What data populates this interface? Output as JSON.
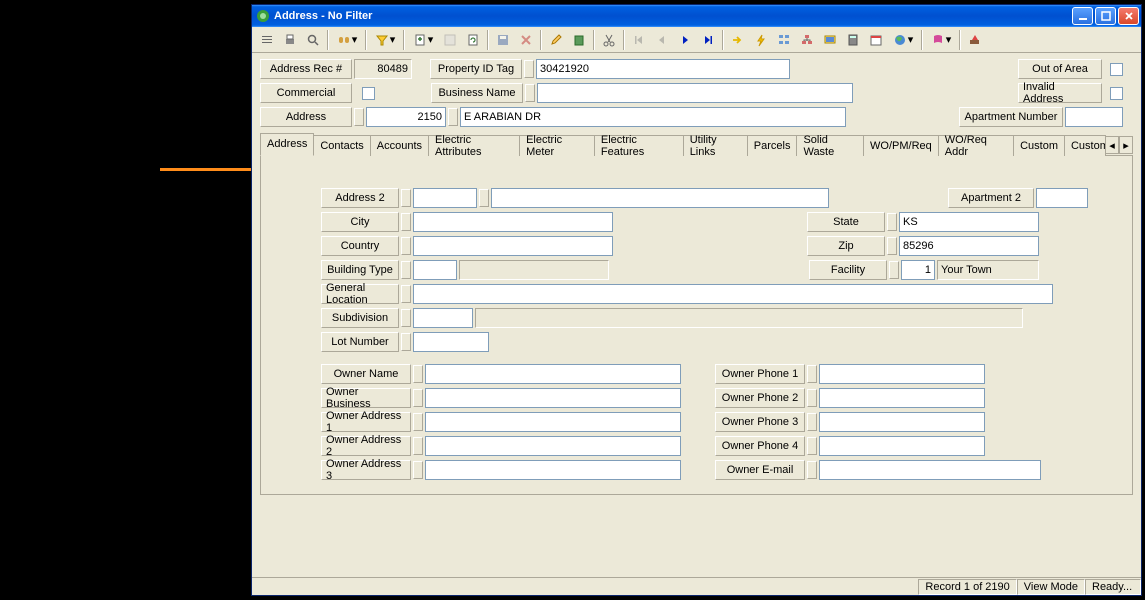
{
  "window": {
    "title": "Address - No Filter"
  },
  "header": {
    "addressRecLabel": "Address Rec #",
    "addressRecValue": "80489",
    "propertyIdTagLabel": "Property ID Tag",
    "propertyIdTagValue": "30421920",
    "outOfAreaLabel": "Out of Area",
    "commercialLabel": "Commercial",
    "businessNameLabel": "Business Name",
    "businessNameValue": "",
    "invalidAddressLabel": "Invalid Address",
    "addressLabel": "Address",
    "addressNumValue": "2150",
    "addressStreetValue": "E ARABIAN DR",
    "apartmentNumberLabel": "Apartment Number",
    "apartmentNumberValue": ""
  },
  "tabs": [
    "Address",
    "Contacts",
    "Accounts",
    "Electric Attributes",
    "Electric Meter",
    "Electric Features",
    "Utility Links",
    "Parcels",
    "Solid Waste",
    "WO/PM/Req",
    "WO/Req Addr",
    "Custom",
    "Custom"
  ],
  "form": {
    "address2Label": "Address 2",
    "address2Num": "",
    "address2Street": "",
    "apartment2Label": "Apartment 2",
    "apartment2Value": "",
    "cityLabel": "City",
    "cityValue": "",
    "stateLabel": "State",
    "stateValue": "KS",
    "countryLabel": "Country",
    "countryValue": "",
    "zipLabel": "Zip",
    "zipValue": "85296",
    "buildingTypeLabel": "Building Type",
    "buildingTypeValue": "",
    "facilityLabel": "Facility",
    "facilityCode": "1",
    "facilityName": "Your Town",
    "generalLocationLabel": "General Location",
    "generalLocationValue": "",
    "subdivisionLabel": "Subdivision",
    "subdivisionCode": "",
    "subdivisionName": "",
    "lotNumberLabel": "Lot Number",
    "lotNumberValue": "",
    "ownerNameLabel": "Owner Name",
    "ownerNameValue": "",
    "ownerPhone1Label": "Owner Phone 1",
    "ownerPhone1Value": "",
    "ownerBusinessLabel": "Owner Business",
    "ownerBusinessValue": "",
    "ownerPhone2Label": "Owner Phone 2",
    "ownerPhone2Value": "",
    "ownerAddress1Label": "Owner Address 1",
    "ownerAddress1Value": "",
    "ownerPhone3Label": "Owner Phone 3",
    "ownerPhone3Value": "",
    "ownerAddress2Label": "Owner Address 2",
    "ownerAddress2Value": "",
    "ownerPhone4Label": "Owner Phone 4",
    "ownerPhone4Value": "",
    "ownerAddress3Label": "Owner Address 3",
    "ownerAddress3Value": "",
    "ownerEmailLabel": "Owner E-mail",
    "ownerEmailValue": ""
  },
  "status": {
    "record": "Record 1 of 2190",
    "mode": "View Mode",
    "ready": "Ready..."
  }
}
